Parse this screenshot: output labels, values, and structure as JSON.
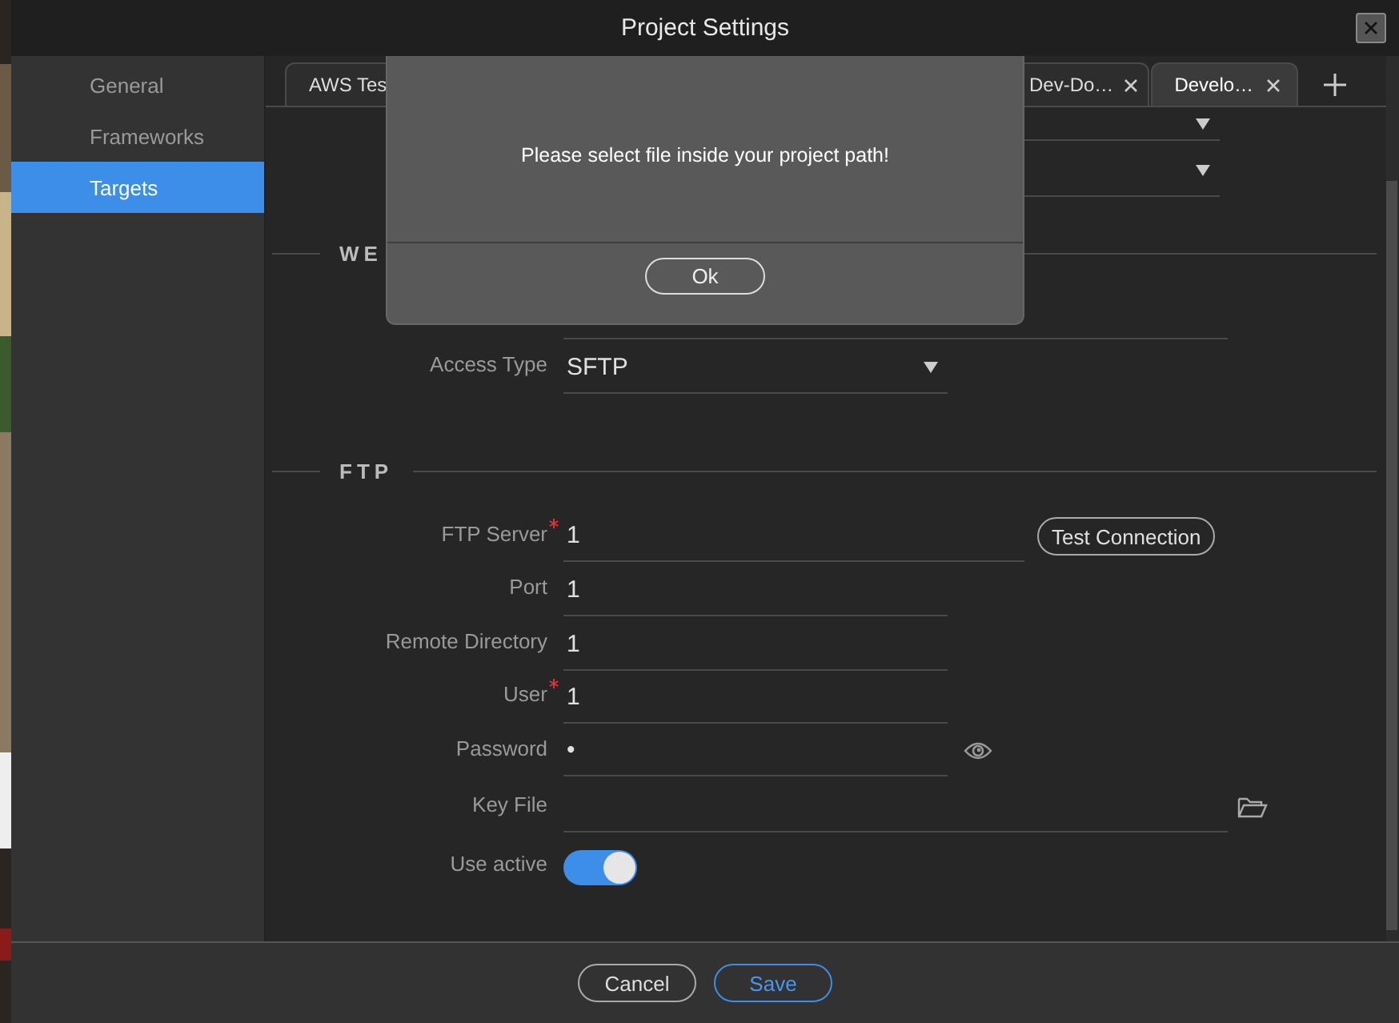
{
  "window": {
    "title": "Project Settings"
  },
  "sidebar": {
    "items": [
      {
        "label": "General",
        "selected": false
      },
      {
        "label": "Frameworks",
        "selected": false
      },
      {
        "label": "Targets",
        "selected": true
      }
    ]
  },
  "tabs": [
    {
      "label": "AWS Tes",
      "selected": false,
      "closable": false
    },
    {
      "label": "Dev-Do…",
      "selected": false,
      "closable": true
    },
    {
      "label": "Develo…",
      "selected": true,
      "closable": true
    }
  ],
  "web": {
    "title": "WE",
    "rows": [
      {
        "kind": "dropdown"
      },
      {
        "kind": "dropdown"
      },
      {
        "kind": "text"
      }
    ],
    "access_type": {
      "label": "Access Type",
      "value": "SFTP"
    }
  },
  "ftp": {
    "title": "FTP",
    "fields": [
      {
        "kind": "text",
        "label": "FTP Server",
        "required": true,
        "value": "1",
        "action": "Test Connection"
      },
      {
        "kind": "text",
        "label": "Port",
        "required": false,
        "value": "1"
      },
      {
        "kind": "text",
        "label": "Remote Directory",
        "required": false,
        "value": "1"
      },
      {
        "kind": "text",
        "label": "User",
        "required": true,
        "value": "1"
      },
      {
        "kind": "password",
        "label": "Password",
        "required": false,
        "value": "•"
      },
      {
        "kind": "file",
        "label": "Key File",
        "required": false
      },
      {
        "kind": "toggle",
        "label": "Use active",
        "required": false,
        "on": true
      }
    ]
  },
  "dialog": {
    "message": "Please select file inside your project path!",
    "button": "Ok"
  },
  "footer": {
    "buttons": [
      {
        "label": "Cancel",
        "primary": false
      },
      {
        "label": "Save",
        "primary": true
      }
    ]
  }
}
